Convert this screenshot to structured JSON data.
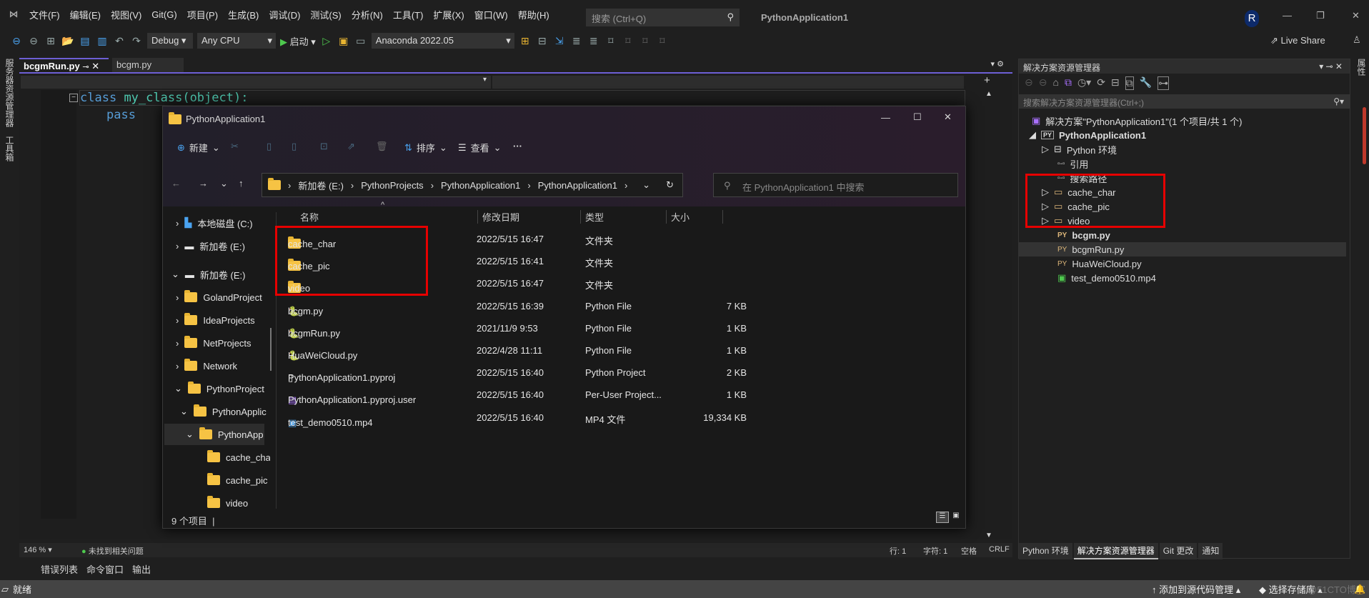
{
  "window": {
    "title": "PythonApplication1",
    "avatar": "R"
  },
  "menu": [
    "文件(F)",
    "编辑(E)",
    "视图(V)",
    "Git(G)",
    "项目(P)",
    "生成(B)",
    "调试(D)",
    "测试(S)",
    "分析(N)",
    "工具(T)",
    "扩展(X)",
    "窗口(W)",
    "帮助(H)"
  ],
  "search": {
    "placeholder": "搜索 (Ctrl+Q)"
  },
  "toolbar": {
    "config": "Debug",
    "platform": "Any CPU",
    "start": "启动",
    "env": "Anaconda 2022.05",
    "live_share": "Live Share"
  },
  "side_tabs": {
    "left": [
      "服务器资源管理器",
      "工具箱"
    ],
    "right": "属性"
  },
  "doc_tabs": [
    {
      "label": "bcgmRun.py",
      "active": true
    },
    {
      "label": "bcgm.py",
      "active": false
    }
  ],
  "code": {
    "line1_kw": "class",
    "line1_name": "my_class",
    "line1_rest": "(object):",
    "line2": "pass"
  },
  "editor_status": {
    "zoom": "146 %",
    "issues": "未找到相关问题",
    "line": "行: 1",
    "char": "字符: 1",
    "spaces": "空格",
    "eol": "CRLF"
  },
  "explorer": {
    "title": "PythonApplication1",
    "commands": {
      "new": "新建",
      "sort": "排序",
      "view": "查看"
    },
    "breadcrumb": [
      "新加卷 (E:)",
      "PythonProjects",
      "PythonApplication1",
      "PythonApplication1"
    ],
    "search_placeholder": "在 PythonApplication1 中搜索",
    "nav": [
      {
        "label": "本地磁盘 (C:)"
      },
      {
        "label": "新加卷 (E:)"
      },
      {
        "label": "新加卷 (E:)"
      },
      {
        "label": "GolandProject"
      },
      {
        "label": "IdeaProjects"
      },
      {
        "label": "NetProjects"
      },
      {
        "label": "Network"
      },
      {
        "label": "PythonProject"
      },
      {
        "label": "PythonApplic"
      },
      {
        "label": "PythonApp"
      },
      {
        "label": "cache_cha"
      },
      {
        "label": "cache_pic"
      },
      {
        "label": "video"
      }
    ],
    "columns": [
      "名称",
      "修改日期",
      "类型",
      "大小"
    ],
    "files": [
      {
        "name": "cache_char",
        "date": "2022/5/15 16:47",
        "type": "文件夹",
        "size": "",
        "icon": "folder"
      },
      {
        "name": "cache_pic",
        "date": "2022/5/15 16:41",
        "type": "文件夹",
        "size": "",
        "icon": "folder"
      },
      {
        "name": "video",
        "date": "2022/5/15 16:47",
        "type": "文件夹",
        "size": "",
        "icon": "folder"
      },
      {
        "name": "bcgm.py",
        "date": "2022/5/15 16:39",
        "type": "Python File",
        "size": "7 KB",
        "icon": "python"
      },
      {
        "name": "bcgmRun.py",
        "date": "2021/11/9 9:53",
        "type": "Python File",
        "size": "1 KB",
        "icon": "python"
      },
      {
        "name": "HuaWeiCloud.py",
        "date": "2022/4/28 11:11",
        "type": "Python File",
        "size": "1 KB",
        "icon": "python"
      },
      {
        "name": "PythonApplication1.pyproj",
        "date": "2022/5/15 16:40",
        "type": "Python Project",
        "size": "2 KB",
        "icon": "file"
      },
      {
        "name": "PythonApplication1.pyproj.user",
        "date": "2022/5/15 16:40",
        "type": "Per-User Project...",
        "size": "1 KB",
        "icon": "vs"
      },
      {
        "name": "test_demo0510.mp4",
        "date": "2022/5/15 16:40",
        "type": "MP4 文件",
        "size": "19,334 KB",
        "icon": "video"
      }
    ],
    "status": "9 个项目"
  },
  "solution": {
    "title": "解决方案资源管理器",
    "search_placeholder": "搜索解决方案资源管理器(Ctrl+;)",
    "items": [
      {
        "label": "解决方案\"PythonApplication1\"(1 个项目/共 1 个)"
      },
      {
        "label": "PythonApplication1"
      },
      {
        "label": "Python 环境"
      },
      {
        "label": "引用"
      },
      {
        "label": "搜索路径"
      },
      {
        "label": "cache_char"
      },
      {
        "label": "cache_pic"
      },
      {
        "label": "video"
      },
      {
        "label": "bcgm.py"
      },
      {
        "label": "bcgmRun.py"
      },
      {
        "label": "HuaWeiCloud.py"
      },
      {
        "label": "test_demo0510.mp4"
      }
    ],
    "bottom_tabs": [
      "Python 环境",
      "解决方案资源管理器",
      "Git 更改",
      "通知"
    ]
  },
  "bottom_tabs": [
    "错误列表",
    "命令窗口",
    "输出"
  ],
  "statusbar": {
    "ready": "就绪",
    "add_source": "添加到源代码管理",
    "select_repo": "选择存储库",
    "watermark": "@51CTO博客"
  },
  "colors": {
    "accent": "#6d5fd5",
    "highlight": "#e60000",
    "folder": "#f6c344"
  }
}
